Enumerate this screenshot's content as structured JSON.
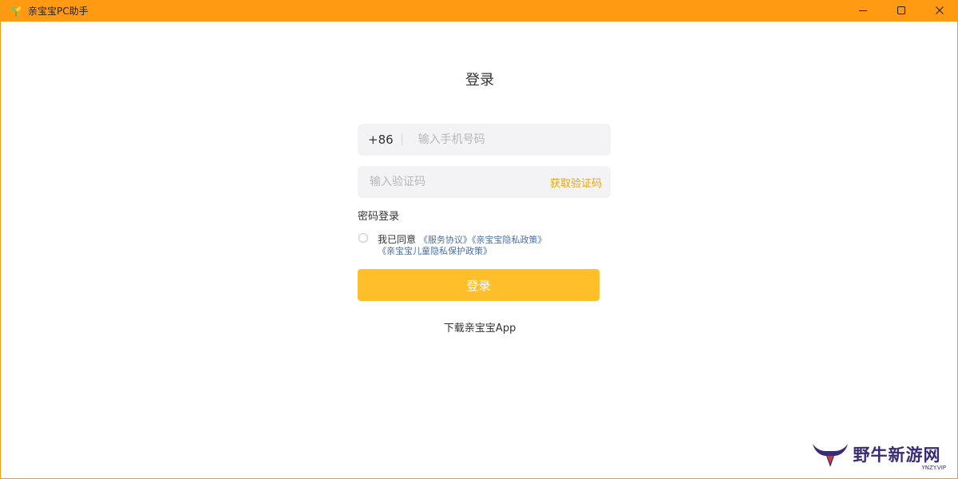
{
  "window": {
    "title": "亲宝宝PC助手",
    "controls": {
      "minimize_icon": "minimize-icon",
      "maximize_icon": "maximize-icon",
      "close_icon": "close-icon"
    }
  },
  "login": {
    "title": "登录",
    "phone": {
      "country_code": "+86",
      "placeholder": "输入手机号码",
      "value": ""
    },
    "code": {
      "placeholder": "输入验证码",
      "value": "",
      "get_code_label": "获取验证码"
    },
    "password_login_label": "密码登录",
    "agreement": {
      "checked": false,
      "prefix": "我已同意",
      "links": [
        "《服务协议》",
        "《亲宝宝隐私政策》",
        "《亲宝宝儿童隐私保护政策》"
      ]
    },
    "submit_label": "登录",
    "download_label": "下载亲宝宝App"
  },
  "watermark": {
    "name": "野牛新游网",
    "url": "YNZY.VIP"
  },
  "colors": {
    "titlebar": "#ff9a12",
    "accent": "#ffbf2b",
    "get_code": "#f0a500",
    "link": "#4a6fa5",
    "watermark": "#3b2a75"
  }
}
